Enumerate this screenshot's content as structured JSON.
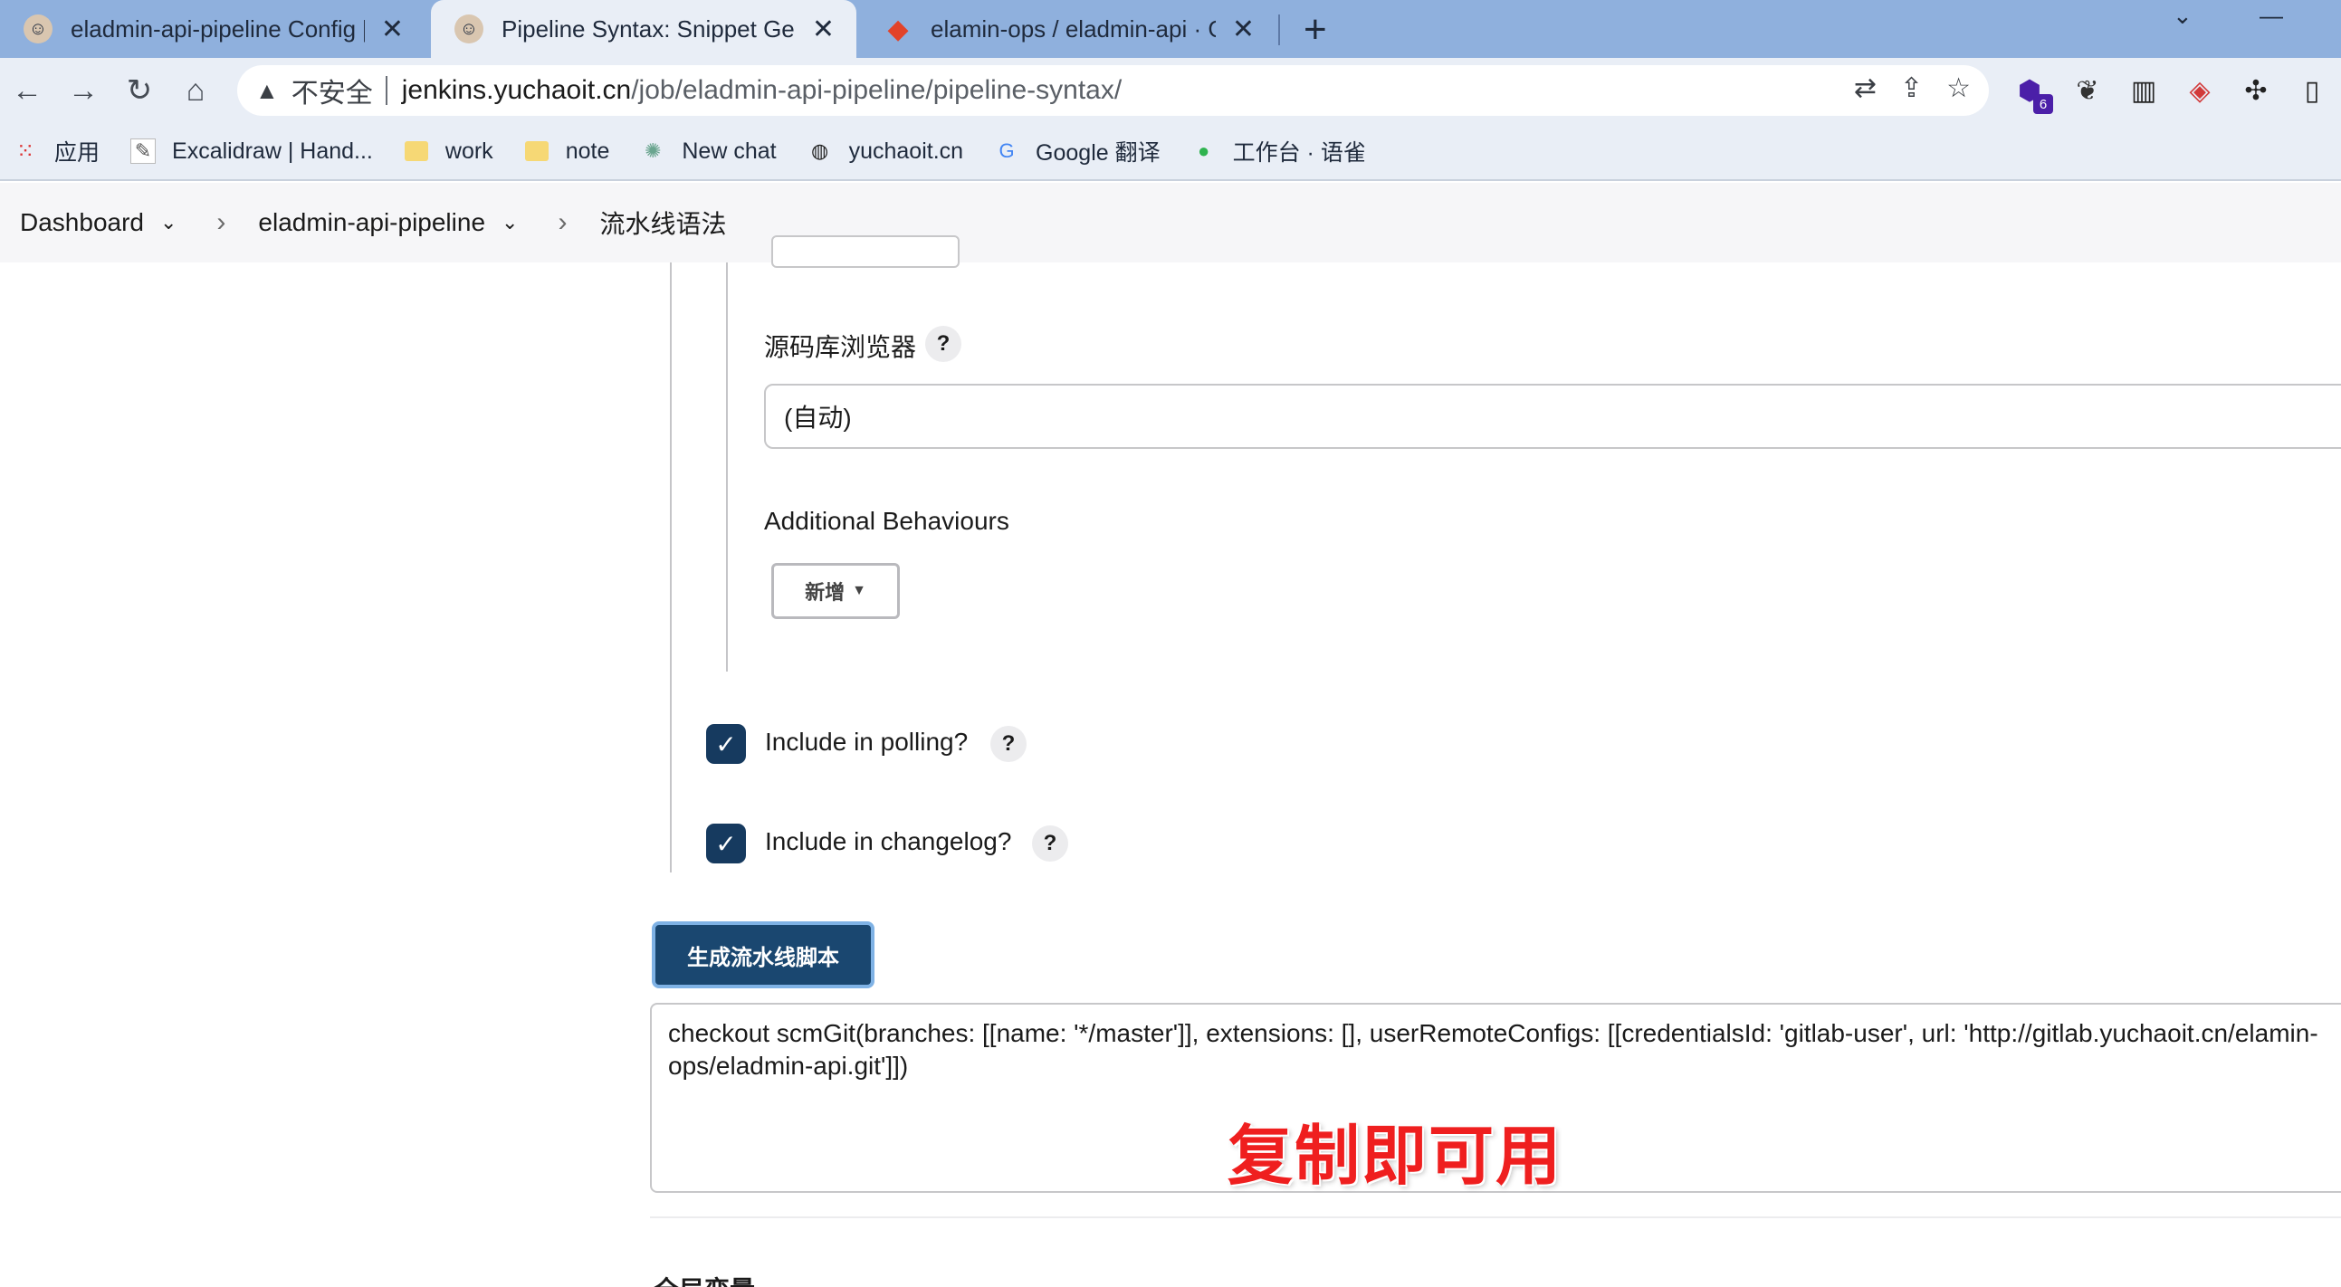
{
  "browser": {
    "tabs": [
      {
        "title": "eladmin-api-pipeline Config [J",
        "favicon": "jenkins-butler-icon",
        "active": false
      },
      {
        "title": "Pipeline Syntax: Snippet Gene",
        "favicon": "jenkins-butler-icon",
        "active": true
      },
      {
        "title": "elamin-ops / eladmin-api · Git",
        "favicon": "gitlab-icon",
        "active": false
      }
    ],
    "address": {
      "security_label": "不安全",
      "host": "jenkins.yuchaoit.cn",
      "path": "/job/eladmin-api-pipeline/pipeline-syntax/"
    },
    "extension_badge": "6",
    "bookmarks": [
      {
        "label": "应用",
        "icon": "apps-grid-icon"
      },
      {
        "label": "Excalidraw | Hand...",
        "icon": "excalidraw-icon"
      },
      {
        "label": "work",
        "icon": "folder-icon"
      },
      {
        "label": "note",
        "icon": "folder-icon"
      },
      {
        "label": "New chat",
        "icon": "openai-icon"
      },
      {
        "label": "yuchaoit.cn",
        "icon": "globe-icon"
      },
      {
        "label": "Google 翻译",
        "icon": "google-translate-icon"
      },
      {
        "label": "工作台 · 语雀",
        "icon": "yuque-icon"
      }
    ]
  },
  "breadcrumb": {
    "items": [
      "Dashboard",
      "eladmin-api-pipeline",
      "流水线语法"
    ]
  },
  "form": {
    "repo_browser_label": "源码库浏览器",
    "repo_browser_value": "(自动)",
    "additional_behaviours_label": "Additional Behaviours",
    "add_button_label": "新增",
    "include_polling_label": "Include in polling?",
    "include_polling_checked": true,
    "include_changelog_label": "Include in changelog?",
    "include_changelog_checked": true,
    "help_glyph": "?",
    "generate_button_label": "生成流水线脚本",
    "generated_script": "checkout scmGit(branches: [[name: '*/master']], extensions: [], userRemoteConfigs: [[credentialsId: 'gitlab-user', url: 'http://gitlab.yuchaoit.cn/elamin-ops/eladmin-api.git']])",
    "overlay_note": "复制即可用",
    "cut_heading": "全局变量"
  },
  "colors": {
    "tabstrip": "#8fb0dd",
    "toolbar": "#e9eef6",
    "checkbox": "#163a5f",
    "primary_button": "#1a4770",
    "overlay_text": "#ef1f1f"
  }
}
